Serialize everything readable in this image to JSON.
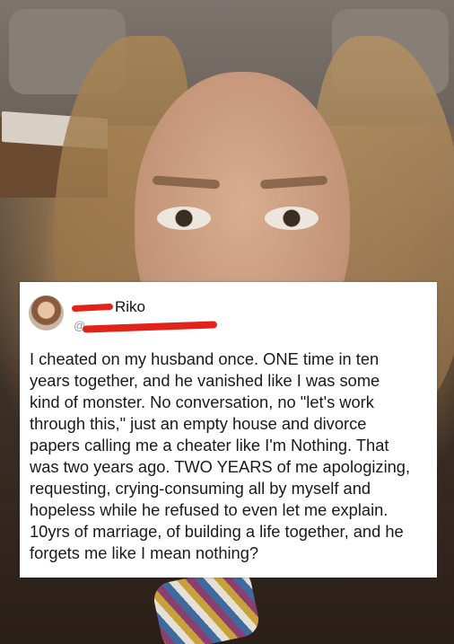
{
  "post": {
    "display_name": "Riko",
    "handle": "@",
    "text_lines": [
      "I cheated on my husband once. ONE time in ten",
      "years together, and  he vanished like I was some",
      "kind of monster. No conversation, no \"let's work",
      "through this,\" just an empty house and divorce",
      "papers calling me a cheater like I'm Nothing. That",
      "was two years ago. TWO YEARS of me apologizing,",
      "requesting,  crying-consuming all by myself  and",
      "hopeless while he refused to even let me explain.",
      "10yrs of marriage, of building a life together, and he",
      "forgets me  like  I mean nothing?"
    ]
  },
  "colors": {
    "redaction": "#e2231a",
    "card_bg": "#ffffff",
    "handle": "#8b98a5"
  }
}
